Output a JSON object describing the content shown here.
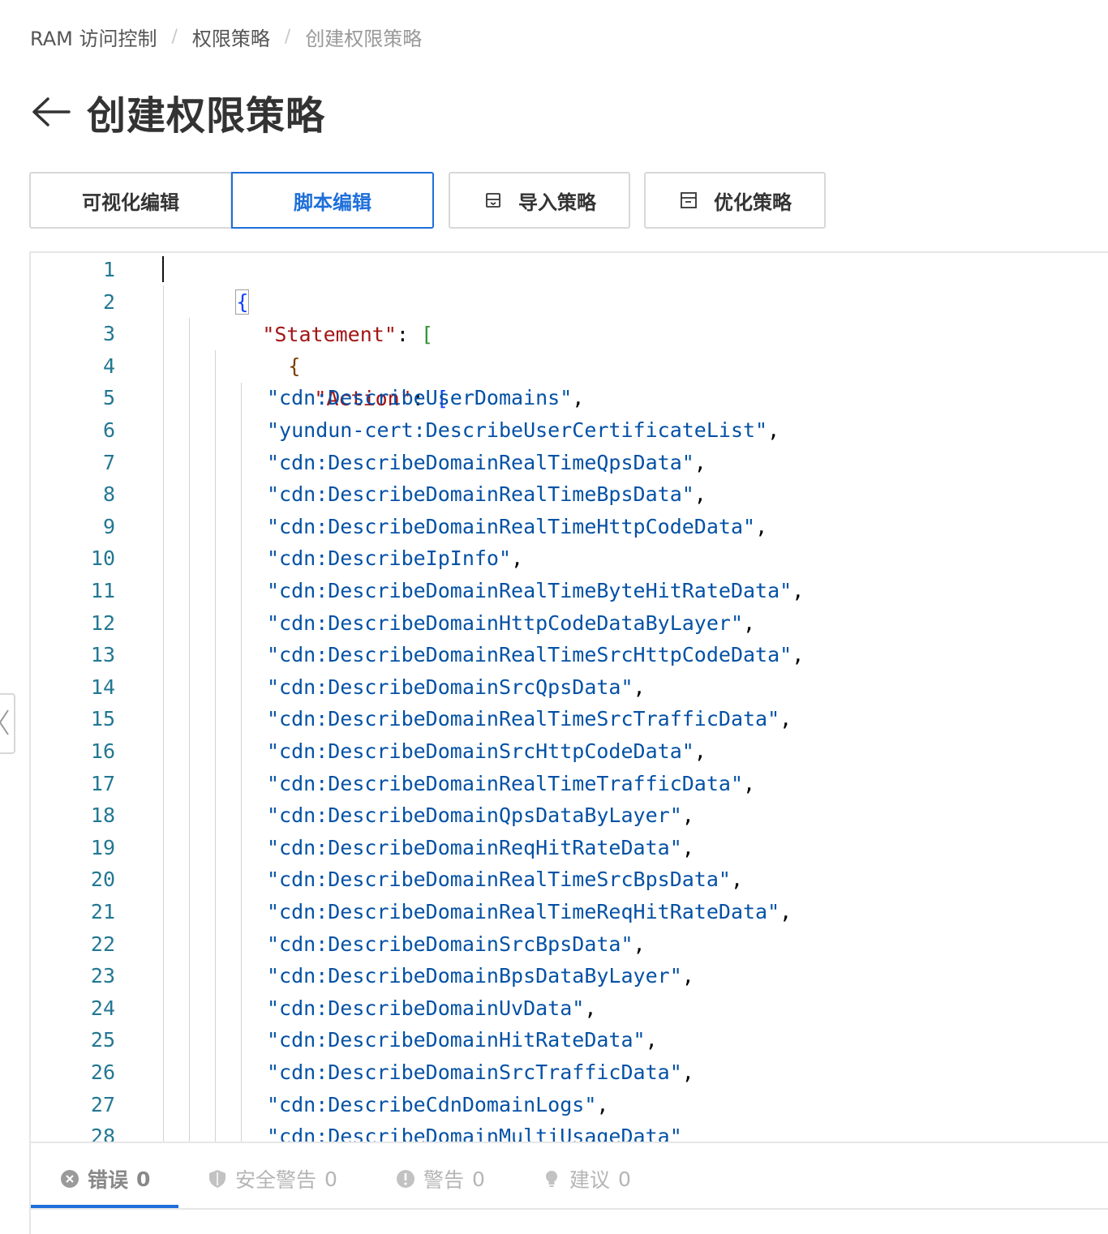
{
  "breadcrumb": [
    "RAM 访问控制",
    "权限策略",
    "创建权限策略"
  ],
  "breadcrumb_separator": "/",
  "page_title": "创建权限策略",
  "toolbar": {
    "visual_edit": "可视化编辑",
    "script_edit": "脚本编辑",
    "import_policy": "导入策略",
    "optimize_policy": "优化策略"
  },
  "editor": {
    "line_numbers": [
      "1",
      "2",
      "3",
      "4",
      "5",
      "6",
      "7",
      "8",
      "9",
      "10",
      "11",
      "12",
      "13",
      "14",
      "15",
      "16",
      "17",
      "18",
      "19",
      "20",
      "21",
      "22",
      "23",
      "24",
      "25",
      "26",
      "27",
      "28"
    ],
    "line1_brace": "{",
    "line2_key": "\"Statement\"",
    "line2_colon": ": ",
    "line2_bracket": "[",
    "line3_brace": "{",
    "line4_key": "\"Action\"",
    "line4_colon": ": ",
    "line4_bracket": "[",
    "actions": [
      "\"cdn:DescribeUserDomains\"",
      "\"yundun-cert:DescribeUserCertificateList\"",
      "\"cdn:DescribeDomainRealTimeQpsData\"",
      "\"cdn:DescribeDomainRealTimeBpsData\"",
      "\"cdn:DescribeDomainRealTimeHttpCodeData\"",
      "\"cdn:DescribeIpInfo\"",
      "\"cdn:DescribeDomainRealTimeByteHitRateData\"",
      "\"cdn:DescribeDomainHttpCodeDataByLayer\"",
      "\"cdn:DescribeDomainRealTimeSrcHttpCodeData\"",
      "\"cdn:DescribeDomainSrcQpsData\"",
      "\"cdn:DescribeDomainRealTimeSrcTrafficData\"",
      "\"cdn:DescribeDomainSrcHttpCodeData\"",
      "\"cdn:DescribeDomainRealTimeTrafficData\"",
      "\"cdn:DescribeDomainQpsDataByLayer\"",
      "\"cdn:DescribeDomainReqHitRateData\"",
      "\"cdn:DescribeDomainRealTimeSrcBpsData\"",
      "\"cdn:DescribeDomainRealTimeReqHitRateData\"",
      "\"cdn:DescribeDomainSrcBpsData\"",
      "\"cdn:DescribeDomainBpsDataByLayer\"",
      "\"cdn:DescribeDomainUvData\"",
      "\"cdn:DescribeDomainHitRateData\"",
      "\"cdn:DescribeDomainSrcTrafficData\"",
      "\"cdn:DescribeCdnDomainLogs\"",
      "\"cdn:DescribeDomainMultiUsageData\""
    ],
    "comma": ","
  },
  "problems": {
    "errors_label": "错误",
    "errors_count": "0",
    "security_label": "安全警告",
    "security_count": "0",
    "warnings_label": "警告",
    "warnings_count": "0",
    "suggestions_label": "建议",
    "suggestions_count": "0"
  },
  "colors": {
    "accent": "#1e6fd9",
    "json_key": "#a31515",
    "json_string": "#0451a5",
    "line_number": "#237893"
  },
  "icons": {
    "back": "arrow-left-icon",
    "import": "archive-box-icon",
    "optimize": "panel-icon",
    "errors": "x-circle-icon",
    "security": "shield-icon",
    "warnings": "exclamation-circle-icon",
    "suggestions": "lightbulb-icon",
    "side_handle": "chevron-left-icon"
  }
}
